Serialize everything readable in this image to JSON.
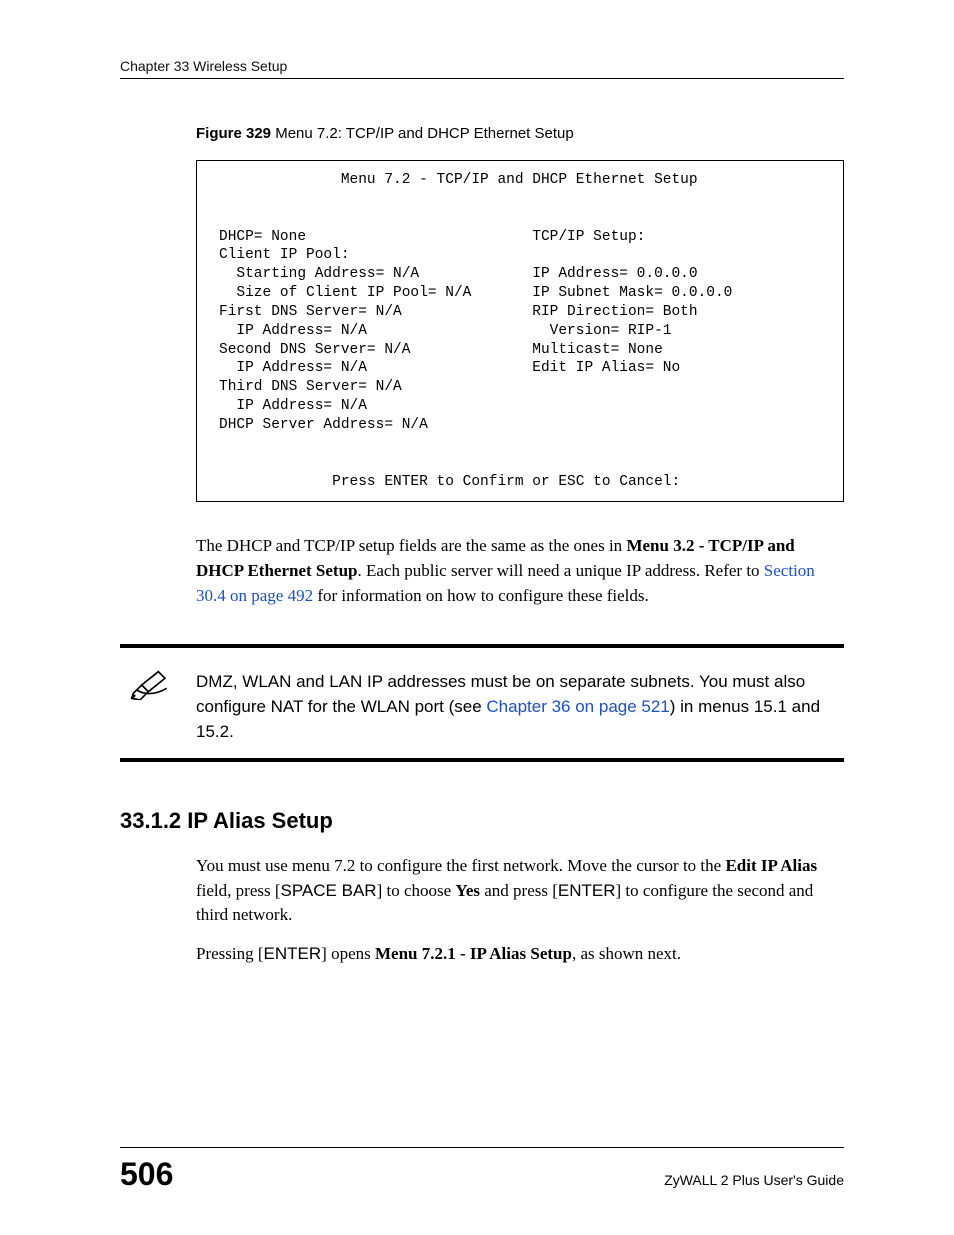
{
  "header": {
    "running": "Chapter 33 Wireless Setup"
  },
  "figure": {
    "label": "Figure 329",
    "caption": "   Menu 7.2: TCP/IP and DHCP Ethernet Setup",
    "terminal": "              Menu 7.2 - TCP/IP and DHCP Ethernet Setup\n\n\nDHCP= None                          TCP/IP Setup:\nClient IP Pool:\n  Starting Address= N/A             IP Address= 0.0.0.0\n  Size of Client IP Pool= N/A       IP Subnet Mask= 0.0.0.0\nFirst DNS Server= N/A               RIP Direction= Both\n  IP Address= N/A                     Version= RIP-1\nSecond DNS Server= N/A              Multicast= None\n  IP Address= N/A                   Edit IP Alias= No\nThird DNS Server= N/A\n  IP Address= N/A\nDHCP Server Address= N/A\n\n\n             Press ENTER to Confirm or ESC to Cancel:"
  },
  "para1": {
    "pre": "The DHCP and TCP/IP setup fields are the same as the ones in ",
    "bold1": "Menu 3.2 - TCP/IP and DHCP Ethernet Setup",
    "mid": ". Each public server will need a unique IP address. Refer to ",
    "link": "Section 30.4 on page 492",
    "post": " for information on how to configure these fields."
  },
  "callout": {
    "pre": "DMZ, WLAN and LAN IP addresses must be on separate subnets. You must also configure NAT for the WLAN port (see ",
    "link": "Chapter 36 on page 521",
    "post": ") in menus 15.1 and 15.2."
  },
  "section": {
    "number": "33.1.2",
    "title": "  IP Alias Setup"
  },
  "instr1": {
    "t1": "You must use menu 7.2 to configure the first network. Move the cursor to the ",
    "b1": "Edit IP Alias",
    "t2": " field, press [",
    "k1": "SPACE BAR",
    "t3": "] to choose ",
    "b2": "Yes",
    "t4": " and press [",
    "k2": "ENTER",
    "t5": "] to configure the second and third network."
  },
  "instr2": {
    "t1": "Pressing [",
    "k1": "ENTER",
    "t2": "] opens ",
    "b1": "Menu 7.2.1 - IP Alias Setup",
    "t3": ", as shown next."
  },
  "footer": {
    "page": "506",
    "guide": "ZyWALL 2 Plus User's Guide"
  }
}
